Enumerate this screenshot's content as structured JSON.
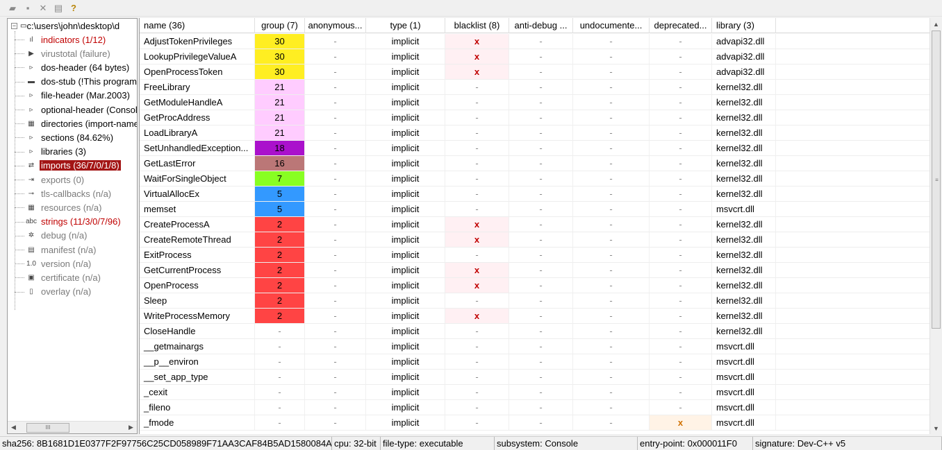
{
  "toolbar": {
    "buttons": [
      {
        "name": "open",
        "icon": "folder-open-icon",
        "glyph": "▰"
      },
      {
        "name": "save",
        "icon": "save-icon",
        "glyph": "▪"
      },
      {
        "name": "close",
        "icon": "close-icon",
        "glyph": "✕"
      },
      {
        "name": "copy",
        "icon": "clipboard-icon",
        "glyph": "▤"
      },
      {
        "name": "help",
        "icon": "help-icon",
        "glyph": "?"
      }
    ]
  },
  "tree": {
    "root": {
      "label": "c:\\users\\john\\desktop\\d",
      "expander": "−"
    },
    "items": [
      {
        "label": "indicators (1/12)",
        "style": "red",
        "icon": "chart-icon",
        "glyph": "ıl"
      },
      {
        "label": "virustotal (failure)",
        "style": "gray",
        "icon": "virustotal-icon",
        "glyph": "▶"
      },
      {
        "label": "dos-header (64 bytes)",
        "style": "normal",
        "icon": "chevron-right-icon",
        "glyph": "▹"
      },
      {
        "label": "dos-stub (!This program cannot be run)",
        "style": "normal",
        "icon": "console-icon",
        "glyph": "▬"
      },
      {
        "label": "file-header (Mar.2003)",
        "style": "normal",
        "icon": "chevron-right-icon",
        "glyph": "▹"
      },
      {
        "label": "optional-header (Console)",
        "style": "normal",
        "icon": "chevron-right-icon",
        "glyph": "▹"
      },
      {
        "label": "directories (import-name)",
        "style": "normal",
        "icon": "directories-icon",
        "glyph": "▦"
      },
      {
        "label": "sections (84.62%)",
        "style": "normal",
        "icon": "chevron-right-icon",
        "glyph": "▹"
      },
      {
        "label": "libraries (3)",
        "style": "normal",
        "icon": "chevron-right-icon",
        "glyph": "▹"
      },
      {
        "label": "imports (36/7/0/1/8)",
        "style": "selected",
        "icon": "imports-icon",
        "glyph": "⇄"
      },
      {
        "label": "exports (0)",
        "style": "gray",
        "icon": "exports-icon",
        "glyph": "⇥"
      },
      {
        "label": "tls-callbacks (n/a)",
        "style": "gray",
        "icon": "key-icon",
        "glyph": "⊸"
      },
      {
        "label": "resources (n/a)",
        "style": "gray",
        "icon": "resources-icon",
        "glyph": "▦"
      },
      {
        "label": "strings (11/3/0/7/96)",
        "style": "red",
        "icon": "strings-icon",
        "glyph": "abc"
      },
      {
        "label": "debug (n/a)",
        "style": "gray",
        "icon": "bug-icon",
        "glyph": "✲"
      },
      {
        "label": "manifest (n/a)",
        "style": "gray",
        "icon": "manifest-icon",
        "glyph": "▤"
      },
      {
        "label": "version (n/a)",
        "style": "gray",
        "icon": "version-icon",
        "glyph": "1.0"
      },
      {
        "label": "certificate (n/a)",
        "style": "gray",
        "icon": "certificate-icon",
        "glyph": "▣"
      },
      {
        "label": "overlay (n/a)",
        "style": "gray",
        "icon": "file-icon",
        "glyph": "▯"
      }
    ],
    "hscroll": {
      "left": "◀",
      "thumb": "III",
      "right": "▶"
    }
  },
  "grid": {
    "columns": [
      {
        "key": "name",
        "label": "name (36)"
      },
      {
        "key": "group",
        "label": "group (7)"
      },
      {
        "key": "anonymous",
        "label": "anonymous..."
      },
      {
        "key": "type",
        "label": "type (1)"
      },
      {
        "key": "blacklist",
        "label": "blacklist (8)"
      },
      {
        "key": "antidebug",
        "label": "anti-debug ..."
      },
      {
        "key": "undocumented",
        "label": "undocumente..."
      },
      {
        "key": "deprecated",
        "label": "deprecated..."
      },
      {
        "key": "library",
        "label": "library (3)"
      }
    ],
    "group_colors": {
      "30": "#ffee22",
      "21": "#ffccff",
      "18": "#aa11cc",
      "16": "#bb7777",
      "7": "#88ff22",
      "5": "#3399ff",
      "2": "#ff4444"
    },
    "rows": [
      {
        "name": "AdjustTokenPrivileges",
        "group": "30",
        "anonymous": "-",
        "type": "implicit",
        "blacklist": "x",
        "antidebug": "-",
        "undocumented": "-",
        "deprecated": "-",
        "library": "advapi32.dll"
      },
      {
        "name": "LookupPrivilegeValueA",
        "group": "30",
        "anonymous": "-",
        "type": "implicit",
        "blacklist": "x",
        "antidebug": "-",
        "undocumented": "-",
        "deprecated": "-",
        "library": "advapi32.dll"
      },
      {
        "name": "OpenProcessToken",
        "group": "30",
        "anonymous": "-",
        "type": "implicit",
        "blacklist": "x",
        "antidebug": "-",
        "undocumented": "-",
        "deprecated": "-",
        "library": "advapi32.dll"
      },
      {
        "name": "FreeLibrary",
        "group": "21",
        "anonymous": "-",
        "type": "implicit",
        "blacklist": "-",
        "antidebug": "-",
        "undocumented": "-",
        "deprecated": "-",
        "library": "kernel32.dll"
      },
      {
        "name": "GetModuleHandleA",
        "group": "21",
        "anonymous": "-",
        "type": "implicit",
        "blacklist": "-",
        "antidebug": "-",
        "undocumented": "-",
        "deprecated": "-",
        "library": "kernel32.dll"
      },
      {
        "name": "GetProcAddress",
        "group": "21",
        "anonymous": "-",
        "type": "implicit",
        "blacklist": "-",
        "antidebug": "-",
        "undocumented": "-",
        "deprecated": "-",
        "library": "kernel32.dll"
      },
      {
        "name": "LoadLibraryA",
        "group": "21",
        "anonymous": "-",
        "type": "implicit",
        "blacklist": "-",
        "antidebug": "-",
        "undocumented": "-",
        "deprecated": "-",
        "library": "kernel32.dll"
      },
      {
        "name": "SetUnhandledException...",
        "group": "18",
        "anonymous": "-",
        "type": "implicit",
        "blacklist": "-",
        "antidebug": "-",
        "undocumented": "-",
        "deprecated": "-",
        "library": "kernel32.dll"
      },
      {
        "name": "GetLastError",
        "group": "16",
        "anonymous": "-",
        "type": "implicit",
        "blacklist": "-",
        "antidebug": "-",
        "undocumented": "-",
        "deprecated": "-",
        "library": "kernel32.dll"
      },
      {
        "name": "WaitForSingleObject",
        "group": "7",
        "anonymous": "-",
        "type": "implicit",
        "blacklist": "-",
        "antidebug": "-",
        "undocumented": "-",
        "deprecated": "-",
        "library": "kernel32.dll"
      },
      {
        "name": "VirtualAllocEx",
        "group": "5",
        "anonymous": "-",
        "type": "implicit",
        "blacklist": "-",
        "antidebug": "-",
        "undocumented": "-",
        "deprecated": "-",
        "library": "kernel32.dll"
      },
      {
        "name": "memset",
        "group": "5",
        "anonymous": "-",
        "type": "implicit",
        "blacklist": "-",
        "antidebug": "-",
        "undocumented": "-",
        "deprecated": "-",
        "library": "msvcrt.dll"
      },
      {
        "name": "CreateProcessA",
        "group": "2",
        "anonymous": "-",
        "type": "implicit",
        "blacklist": "x",
        "antidebug": "-",
        "undocumented": "-",
        "deprecated": "-",
        "library": "kernel32.dll"
      },
      {
        "name": "CreateRemoteThread",
        "group": "2",
        "anonymous": "-",
        "type": "implicit",
        "blacklist": "x",
        "antidebug": "-",
        "undocumented": "-",
        "deprecated": "-",
        "library": "kernel32.dll"
      },
      {
        "name": "ExitProcess",
        "group": "2",
        "anonymous": "-",
        "type": "implicit",
        "blacklist": "-",
        "antidebug": "-",
        "undocumented": "-",
        "deprecated": "-",
        "library": "kernel32.dll"
      },
      {
        "name": "GetCurrentProcess",
        "group": "2",
        "anonymous": "-",
        "type": "implicit",
        "blacklist": "x",
        "antidebug": "-",
        "undocumented": "-",
        "deprecated": "-",
        "library": "kernel32.dll"
      },
      {
        "name": "OpenProcess",
        "group": "2",
        "anonymous": "-",
        "type": "implicit",
        "blacklist": "x",
        "antidebug": "-",
        "undocumented": "-",
        "deprecated": "-",
        "library": "kernel32.dll"
      },
      {
        "name": "Sleep",
        "group": "2",
        "anonymous": "-",
        "type": "implicit",
        "blacklist": "-",
        "antidebug": "-",
        "undocumented": "-",
        "deprecated": "-",
        "library": "kernel32.dll"
      },
      {
        "name": "WriteProcessMemory",
        "group": "2",
        "anonymous": "-",
        "type": "implicit",
        "blacklist": "x",
        "antidebug": "-",
        "undocumented": "-",
        "deprecated": "-",
        "library": "kernel32.dll"
      },
      {
        "name": "CloseHandle",
        "group": "-",
        "anonymous": "-",
        "type": "implicit",
        "blacklist": "-",
        "antidebug": "-",
        "undocumented": "-",
        "deprecated": "-",
        "library": "kernel32.dll"
      },
      {
        "name": "__getmainargs",
        "group": "-",
        "anonymous": "-",
        "type": "implicit",
        "blacklist": "-",
        "antidebug": "-",
        "undocumented": "-",
        "deprecated": "-",
        "library": "msvcrt.dll"
      },
      {
        "name": "__p__environ",
        "group": "-",
        "anonymous": "-",
        "type": "implicit",
        "blacklist": "-",
        "antidebug": "-",
        "undocumented": "-",
        "deprecated": "-",
        "library": "msvcrt.dll"
      },
      {
        "name": "__set_app_type",
        "group": "-",
        "anonymous": "-",
        "type": "implicit",
        "blacklist": "-",
        "antidebug": "-",
        "undocumented": "-",
        "deprecated": "-",
        "library": "msvcrt.dll"
      },
      {
        "name": "_cexit",
        "group": "-",
        "anonymous": "-",
        "type": "implicit",
        "blacklist": "-",
        "antidebug": "-",
        "undocumented": "-",
        "deprecated": "-",
        "library": "msvcrt.dll"
      },
      {
        "name": "_fileno",
        "group": "-",
        "anonymous": "-",
        "type": "implicit",
        "blacklist": "-",
        "antidebug": "-",
        "undocumented": "-",
        "deprecated": "-",
        "library": "msvcrt.dll"
      },
      {
        "name": "_fmode",
        "group": "-",
        "anonymous": "-",
        "type": "implicit",
        "blacklist": "-",
        "antidebug": "-",
        "undocumented": "-",
        "deprecated": "x",
        "library": "msvcrt.dll"
      }
    ],
    "vscroll": {
      "up": "▲",
      "grip": "≡",
      "down": "▼"
    }
  },
  "status": [
    {
      "key": "sha256",
      "text": "sha256: 8B1681D1E0377F2F97756C25CD058989F71AA3CAF84B5AD1580084A"
    },
    {
      "key": "cpu",
      "text": "cpu: 32-bit"
    },
    {
      "key": "file-type",
      "text": "file-type: executable"
    },
    {
      "key": "subsystem",
      "text": "subsystem: Console"
    },
    {
      "key": "entry-point",
      "text": "entry-point: 0x000011F0"
    },
    {
      "key": "signature",
      "text": "signature: Dev-C++ v5"
    }
  ],
  "colors": {
    "selection": "#a31515",
    "blacklist_bg": "#fff0f3",
    "deprecated_bg": "#fff3e6",
    "red_text": "#c00000"
  }
}
